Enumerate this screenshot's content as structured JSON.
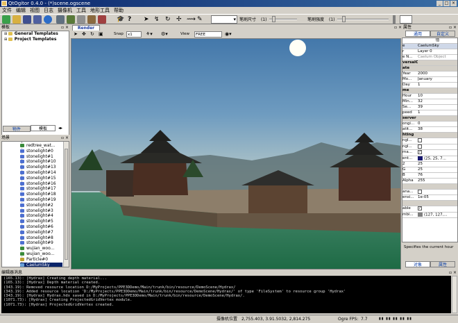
{
  "window": {
    "title": "QtOgitor 0.4.0 - (*)scene.ogscene",
    "buttons": [
      "_",
      "□",
      "×"
    ]
  },
  "menu": [
    "文件",
    "编辑",
    "视图",
    "日志",
    "摄像机",
    "工具",
    "地形工具",
    "帮助"
  ],
  "toolbar": {
    "terrain_size_label": "笔刷尺寸",
    "terrain_size_value": "(1)",
    "terrain_strength_label": "笔刷强度",
    "terrain_strength_value": "(1)",
    "brush_size_fraction": 0.1,
    "brush_strength_fraction": 0.1
  },
  "left_top_panel": {
    "title": "模板",
    "items": [
      "General Templates",
      "Project Templates"
    ],
    "tabs": [
      "物件",
      "模板"
    ]
  },
  "scene_panel": {
    "title": "场景",
    "items": [
      {
        "label": "redtree_wat...",
        "icon": "tree"
      },
      {
        "label": "stonelight#0",
        "icon": "light"
      },
      {
        "label": "stonelight#1",
        "icon": "light"
      },
      {
        "label": "stonelight#10",
        "icon": "light"
      },
      {
        "label": "stonelight#13",
        "icon": "light"
      },
      {
        "label": "stonelight#14",
        "icon": "light"
      },
      {
        "label": "stonelight#15",
        "icon": "light"
      },
      {
        "label": "stonelight#16",
        "icon": "light"
      },
      {
        "label": "stonelight#17",
        "icon": "light"
      },
      {
        "label": "stonelight#18",
        "icon": "light"
      },
      {
        "label": "stonelight#19",
        "icon": "light"
      },
      {
        "label": "stonelight#2",
        "icon": "light"
      },
      {
        "label": "stonelight#3",
        "icon": "light"
      },
      {
        "label": "stonelight#4",
        "icon": "light"
      },
      {
        "label": "stonelight#5",
        "icon": "light"
      },
      {
        "label": "stonelight#6",
        "icon": "light"
      },
      {
        "label": "stonelight#7",
        "icon": "light"
      },
      {
        "label": "stonelight#8",
        "icon": "light"
      },
      {
        "label": "stonelight#9",
        "icon": "light"
      },
      {
        "label": "wujian_woo...",
        "icon": "tree"
      },
      {
        "label": "wujian_woo...",
        "icon": "tree"
      },
      {
        "label": "Particle#0",
        "icon": "particle"
      },
      {
        "label": "CaelumSky",
        "icon": "sky",
        "selected": true
      },
      {
        "label": "HydraxWater",
        "icon": "water"
      }
    ]
  },
  "viewport": {
    "tab": "Render",
    "snap_label": "Snap",
    "snap_value": "x1",
    "view_label": "View",
    "view_value": "FREE"
  },
  "props_panel": {
    "title": "属性",
    "tabs": [
      "通用",
      "自定义"
    ],
    "header": [
      "",
      "值"
    ],
    "rows": [
      {
        "k": "e",
        "v": "CaelumSky",
        "sel": true
      },
      {
        "k": "r",
        "v": "Layer 0"
      },
      {
        "k": "e N...",
        "v": "Caelum Object",
        "dim": true
      },
      {
        "k": "versalClock",
        "v": "",
        "sec": true
      },
      {
        "k": "ate",
        "v": "",
        "sec": true
      },
      {
        "k": "Year",
        "v": "2000"
      },
      {
        "k": "Mo...",
        "v": "January"
      },
      {
        "k": "Day",
        "v": "1"
      },
      {
        "k": "me",
        "v": "",
        "sec": true
      },
      {
        "k": "Hour",
        "v": "10"
      },
      {
        "k": "Min...",
        "v": "32"
      },
      {
        "k": "Se...",
        "v": "39"
      },
      {
        "k": "peed",
        "v": "1"
      },
      {
        "k": "server",
        "v": "",
        "sec": true
      },
      {
        "k": "ongi...",
        "v": "0"
      },
      {
        "k": "atit...",
        "v": "38"
      },
      {
        "k": "hting",
        "v": "",
        "sec": true
      },
      {
        "k": "ngl...",
        "v": "",
        "chk": false
      },
      {
        "k": "ngl...",
        "v": "",
        "chk": false
      },
      {
        "k": "ma...",
        "v": "",
        "chk": true
      },
      {
        "k": "ent...",
        "v": "(25, 25, 7...",
        "color": "#191970"
      },
      {
        "k": "2",
        "v": "25"
      },
      {
        "k": "G",
        "v": "25"
      },
      {
        "k": "B",
        "v": "76"
      },
      {
        "k": "Alpha",
        "v": "255"
      },
      {
        "k": "",
        "v": "",
        "sec": true
      },
      {
        "k": "ana...",
        "v": "",
        "chk": false
      },
      {
        "k": "ensi...",
        "v": "1e-05"
      },
      {
        "k": "",
        "v": "",
        "sec": true
      },
      {
        "k": "able",
        "v": "",
        "chk": true
      },
      {
        "k": "mbi...",
        "v": "(127, 127,...",
        "color": "#7f7f7f"
      }
    ],
    "help": "Specifies the current hour",
    "bottom_tabs": [
      "对象",
      "属性"
    ]
  },
  "console": {
    "title": "编辑器消息",
    "lines": [
      "(165.13): [Hydrax] Creating depth material...",
      "(165.13): [Hydrax] Depth material created.",
      "(343.19): Removed resource location D:/MyProjects/PPE3DDemo/Main/trunk/bin/resource/DemoScene/Hydrax/",
      "(343.19): Added resource location 'D:/MyProjects/PPE3DDemo/Main/trunk/bin/resource/DemoScene/Hydrax/' of type 'FileSystem' to resource group 'Hydrax'",
      "(343.19): [Hydrax] Hydrax.hdx saved in D:/MyProjects/PPE3DDemo/Main/trunk/bin/resource/DemoScene/Hydrax/.",
      "(1071.73): [Hydrax] Creating ProjectedGridVertex module.",
      "(1071.73): [Hydrax] ProjectedGridVertex created."
    ]
  },
  "status": {
    "camera_label": "摄像机位置",
    "camera_value": "2,755.403, 3.91.5032, 2,814.275",
    "fps_label": "Ogre FPS:",
    "fps_value": "7.7"
  }
}
